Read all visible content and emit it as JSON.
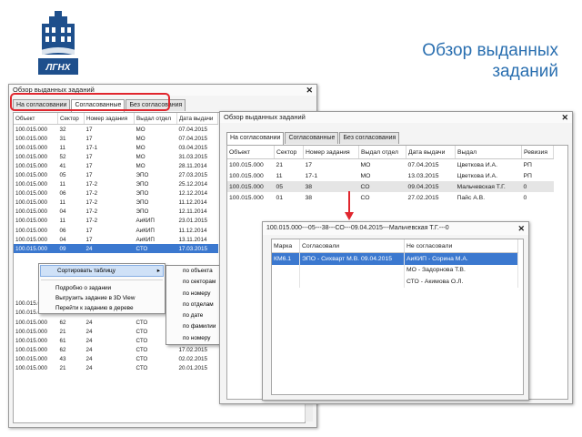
{
  "logo": {
    "text": "ЛГНХ"
  },
  "slide_title": {
    "line1": "Обзор выданных",
    "line2": "заданий"
  },
  "window1": {
    "title": "Обзор выданных заданий",
    "close_glyph": "✕",
    "tabs": [
      "На согласовании",
      "Согласованные",
      "Без согласования"
    ],
    "columns": [
      "Объект",
      "Сектор",
      "Номер задания",
      "Выдал отдел",
      "Дата выдачи"
    ],
    "rows": [
      [
        "100.015.000",
        "32",
        "17",
        "МО",
        "07.04.2015"
      ],
      [
        "100.015.000",
        "31",
        "17",
        "МО",
        "07.04.2015"
      ],
      [
        "100.015.000",
        "11",
        "17-1",
        "МО",
        "03.04.2015"
      ],
      [
        "100.015.000",
        "52",
        "17",
        "МО",
        "31.03.2015"
      ],
      [
        "100.015.000",
        "41",
        "17",
        "МО",
        "28.11.2014"
      ],
      [
        "100.015.000",
        "05",
        "17",
        "ЭПО",
        "27.03.2015"
      ],
      [
        "100.015.000",
        "11",
        "17-2",
        "ЭПО",
        "25.12.2014"
      ],
      [
        "100.015.000",
        "06",
        "17-2",
        "ЭПО",
        "12.12.2014"
      ],
      [
        "100.015.000",
        "11",
        "17-2",
        "ЭПО",
        "11.12.2014"
      ],
      [
        "100.015.000",
        "04",
        "17-2",
        "ЭПО",
        "12.11.2014"
      ],
      [
        "100.015.000",
        "11",
        "17-2",
        "АиКИП",
        "23.01.2015"
      ],
      [
        "100.015.000",
        "06",
        "17",
        "АиКИП",
        "11.12.2014"
      ],
      [
        "100.015.000",
        "04",
        "17",
        "АиКИП",
        "13.11.2014"
      ],
      [
        "100.015.000",
        "09",
        "24",
        "СТО",
        "17.03.2015"
      ],
      [
        "",
        "",
        "",
        "",
        "",
        ""
      ],
      [
        "",
        "",
        "",
        "",
        "",
        ""
      ],
      [
        "",
        "",
        "",
        "",
        "",
        ""
      ],
      [
        "",
        "",
        "",
        "",
        "",
        ""
      ],
      [
        "",
        "",
        "",
        "",
        "",
        ""
      ],
      [
        "100.015.000",
        "22",
        "24",
        "СТО",
        ""
      ],
      [
        "100.015.000",
        "61",
        "24",
        "СТО",
        ""
      ],
      [
        "100.015.000",
        "62",
        "24",
        "СТО",
        ""
      ],
      [
        "100.015.000",
        "21",
        "24",
        "СТО",
        "17.02.2015"
      ],
      [
        "100.015.000",
        "61",
        "24",
        "СТО",
        "17.02.2015"
      ],
      [
        "100.015.000",
        "62",
        "24",
        "СТО",
        "17.02.2015"
      ],
      [
        "100.015.000",
        "43",
        "24",
        "СТО",
        "02.02.2015"
      ],
      [
        "100.015.000",
        "21",
        "24",
        "СТО",
        "20.01.2015"
      ]
    ],
    "selected_row_index": 13
  },
  "context_menu": {
    "items": [
      {
        "label": "Сортировать таблицу",
        "has_submenu": true,
        "arrow": "▸"
      },
      {
        "label": "Подробно о задании"
      },
      {
        "label": "Выгрузить задание в 3D View"
      },
      {
        "label": "Перейти к заданию в дереве"
      }
    ],
    "submenu": [
      "по объекта",
      "по секторам",
      "по номеру",
      "по отделам",
      "по дате",
      "по фамилии",
      "по номеру"
    ]
  },
  "window2": {
    "title": "Обзор выданных заданий",
    "close_glyph": "✕",
    "tabs": [
      "На согласовании",
      "Согласованные",
      "Без согласования"
    ],
    "columns": [
      "Объект",
      "Сектор",
      "Номер задания",
      "Выдал отдел",
      "Дата выдачи",
      "Выдал",
      "Ревизия"
    ],
    "rows": [
      [
        "100.015.000",
        "21",
        "17",
        "МО",
        "07.04.2015",
        "Цветкова И.А.",
        "РП"
      ],
      [
        "100.015.000",
        "11",
        "17-1",
        "МО",
        "13.03.2015",
        "Цветкова И.А.",
        "РП"
      ],
      [
        "100.015.000",
        "05",
        "38",
        "СО",
        "09.04.2015",
        "Мальчевская Т.Г.",
        "0"
      ],
      [
        "100.015.000",
        "01",
        "38",
        "СО",
        "27.02.2015",
        "Пайс А.В.",
        "0"
      ]
    ],
    "highlighted_row_index": 2
  },
  "window3": {
    "title": "100.015.000---05---38---СО---09.04.2015---Мальчевская Т.Г.---0",
    "close_glyph": "✕",
    "columns": [
      "Марка",
      "Согласовали",
      "Не согласовали"
    ],
    "rows": [
      [
        "КМ6.1",
        "ЭПО - Сихварт М.В.  09.04.2015",
        "АиКИП - Сорина М.А."
      ],
      [
        "",
        "",
        "МО - Задорнова Т.В."
      ],
      [
        "",
        "",
        "СТО - Акимова О.Л."
      ]
    ]
  },
  "colors": {
    "title_blue": "#2a6fb0",
    "selection_blue": "#3b78cf",
    "highlight_red": "#e0262e",
    "logo_blue": "#1e4f8c"
  }
}
